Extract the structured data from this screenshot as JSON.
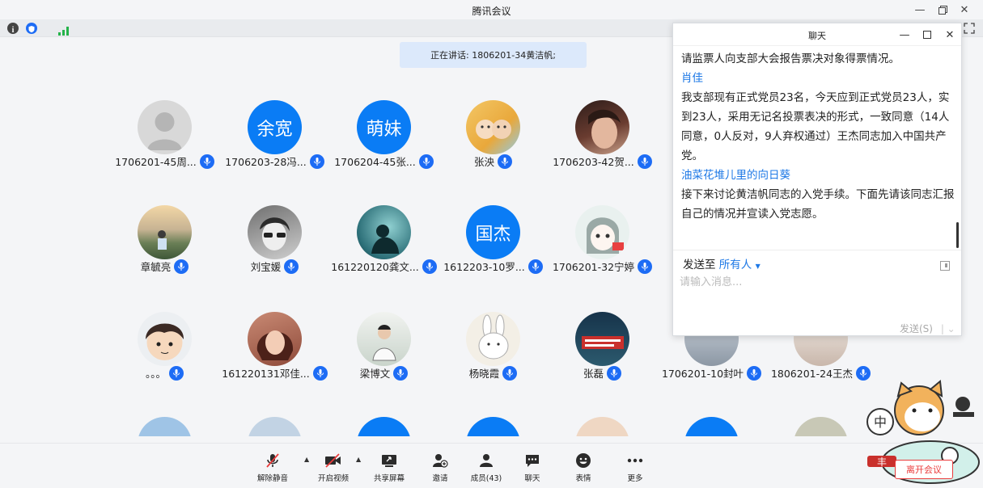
{
  "window": {
    "title": "腾讯会议"
  },
  "speaking": {
    "text": "正在讲话: 1806201-34黄洁帆;"
  },
  "participants": [
    {
      "name": "1706201-45周...",
      "avatar_text": ""
    },
    {
      "name": "1706203-28冯...",
      "avatar_text": "余宽"
    },
    {
      "name": "1706204-45张...",
      "avatar_text": "萌妹"
    },
    {
      "name": "张泱",
      "avatar_text": ""
    },
    {
      "name": "1706203-42贺...",
      "avatar_text": ""
    },
    {
      "name": "章毓亮",
      "avatar_text": ""
    },
    {
      "name": "刘宝媛",
      "avatar_text": ""
    },
    {
      "name": "161220120龚文...",
      "avatar_text": ""
    },
    {
      "name": "1612203-10罗...",
      "avatar_text": "国杰"
    },
    {
      "name": "1706201-32宁婷",
      "avatar_text": ""
    },
    {
      "name": "。。。",
      "avatar_text": ""
    },
    {
      "name": "161220131邓佳...",
      "avatar_text": ""
    },
    {
      "name": "梁博文",
      "avatar_text": ""
    },
    {
      "name": "杨晓霞",
      "avatar_text": ""
    },
    {
      "name": "张磊",
      "avatar_text": ""
    },
    {
      "name": "1706201-10封叶",
      "avatar_text": ""
    },
    {
      "name": "1806201-24王杰",
      "avatar_text": ""
    }
  ],
  "chat": {
    "title": "聊天",
    "messages": [
      {
        "sender": "",
        "text": "请监票人向支部大会报告票决对象得票情况。"
      },
      {
        "sender": "肖佳",
        "text": "我支部现有正式党员23名，今天应到正式党员23人，实到23人，采用无记名投票表决的形式，一致同意（14人同意，0人反对，9人弃权通过）王杰同志加入中国共产党。"
      },
      {
        "sender": "油菜花堆儿里的向日葵",
        "text": "接下来讨论黄洁帆同志的入党手续。下面先请该同志汇报自己的情况并宣读入党志愿。"
      }
    ],
    "send_to_label": "发送至",
    "send_to_target": "所有人",
    "input_placeholder": "请输入消息...",
    "send_button": "发送(S)"
  },
  "toolbar": {
    "unmute": "解除静音",
    "start_video": "开启视频",
    "share_screen": "共享屏幕",
    "invite": "邀请",
    "members": "成员(43)",
    "chat": "聊天",
    "reactions": "表情",
    "more": "更多",
    "leave": "离开会议"
  },
  "colors": {
    "accent": "#0a7cf5",
    "mic": "#1d6cf5",
    "leave": "#ea3b3b",
    "sender": "#1d78e6"
  }
}
